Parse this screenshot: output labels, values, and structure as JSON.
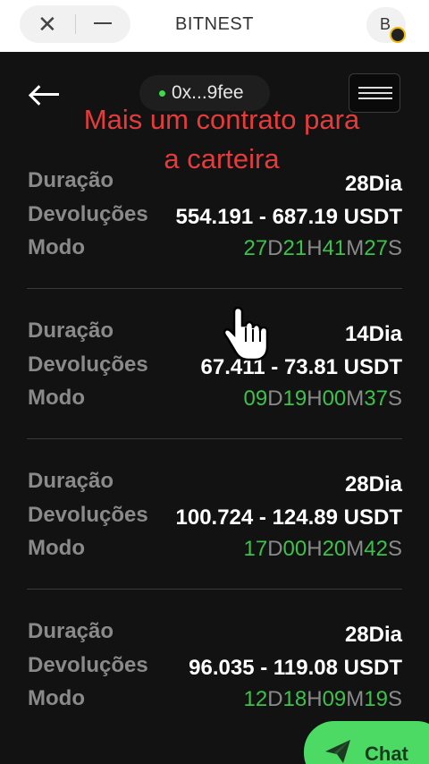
{
  "browser": {
    "close_glyph": "✕",
    "title": "BITNEST",
    "brand_letter": "B"
  },
  "header": {
    "wallet": "0x...9fee"
  },
  "overlay": {
    "line1": "Mais um contrato para",
    "line2": "a carteira"
  },
  "labels": {
    "duration": "Duração",
    "returns": "Devoluções",
    "mode": "Modo"
  },
  "contracts": [
    {
      "duration": "28Dia",
      "returns": "554.191 - 687.19 USDT",
      "timer": {
        "d": "27",
        "h": "21",
        "m": "41",
        "s": "27"
      }
    },
    {
      "duration": "14Dia",
      "returns": "67.411 - 73.81 USDT",
      "timer": {
        "d": "09",
        "h": "19",
        "m": "00",
        "s": "37"
      }
    },
    {
      "duration": "28Dia",
      "returns": "100.724 - 124.89 USDT",
      "timer": {
        "d": "17",
        "h": "00",
        "m": "20",
        "s": "42"
      }
    },
    {
      "duration": "28Dia",
      "returns": "96.035 - 119.08 USDT",
      "timer": {
        "d": "12",
        "h": "18",
        "m": "09",
        "s": "19"
      }
    }
  ],
  "timer_units": {
    "d": "D",
    "h": "H",
    "m": "M",
    "s": "S"
  },
  "chat": {
    "label": "Chat"
  },
  "colors": {
    "accent_green": "#3cc24a",
    "overlay_red": "#e63b3b",
    "chat_green": "#4cd964"
  },
  "icons": [
    "close-icon",
    "minimize-icon",
    "bitnest-brand-icon",
    "back-arrow-icon",
    "hamburger-menu-icon",
    "status-dot-icon",
    "hand-cursor-icon",
    "send-plane-icon"
  ]
}
